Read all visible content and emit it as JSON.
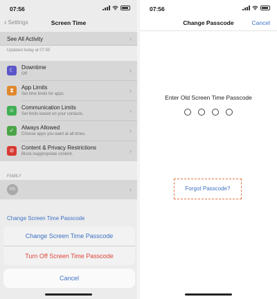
{
  "left": {
    "status_time": "07:56",
    "back_label": "Settings",
    "title": "Screen Time",
    "see_all": "See All Activity",
    "updated": "Updated today at 07:55",
    "items": [
      {
        "title": "Downtime",
        "subtitle": "Off",
        "icon": "moon-icon",
        "color": "#5b56c8",
        "glyph": "☾"
      },
      {
        "title": "App Limits",
        "subtitle": "Set time limits for apps.",
        "icon": "hourglass-icon",
        "color": "#e0882d",
        "glyph": "⧗"
      },
      {
        "title": "Communication Limits",
        "subtitle": "Set limits based on your contacts.",
        "icon": "person-bubble-icon",
        "color": "#3fae52",
        "glyph": "☺"
      },
      {
        "title": "Always Allowed",
        "subtitle": "Choose apps you want at all times.",
        "icon": "check-badge-icon",
        "color": "#4aa547",
        "glyph": "✓"
      },
      {
        "title": "Content & Privacy Restrictions",
        "subtitle": "Block inappropriate content.",
        "icon": "no-entry-icon",
        "color": "#d83a34",
        "glyph": "⊘"
      }
    ],
    "family_header": "FAMILY",
    "family_initials": "RS",
    "change_link": "Change Screen Time Passcode",
    "sheet": {
      "change": "Change Screen Time Passcode",
      "turn_off": "Turn Off Screen Time Passcode",
      "cancel": "Cancel"
    }
  },
  "right": {
    "status_time": "07:56",
    "title": "Change Passcode",
    "cancel": "Cancel",
    "prompt": "Enter Old Screen Time Passcode",
    "forgot": "Forgot Passcode?"
  }
}
